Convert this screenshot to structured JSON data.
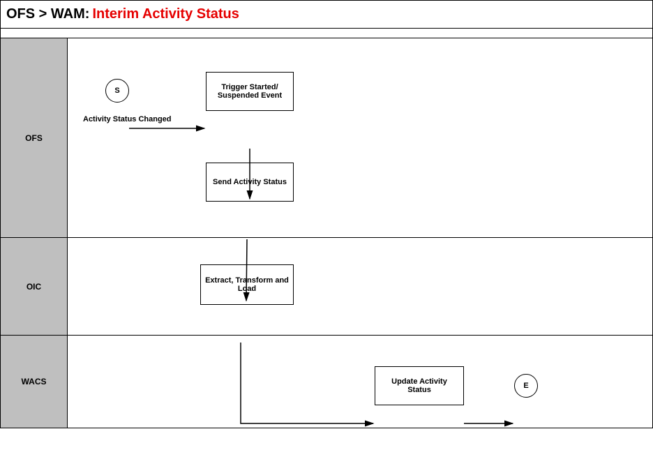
{
  "title": {
    "prefix": "OFS > WAM:",
    "main": "Interim Activity Status"
  },
  "lanes": {
    "ofs": "OFS",
    "oic": "OIC",
    "wacs": "WACS"
  },
  "nodes": {
    "start": "S",
    "end": "E",
    "trigger_box": "Trigger Started/ Suspended Event",
    "send_box": "Send Activity Status",
    "etl_box": "Extract, Transform and Load",
    "update_box": "Update Activity Status"
  },
  "captions": {
    "status_changed": "Activity Status Changed"
  },
  "chart_data": {
    "type": "swimlane-flow",
    "title": "OFS > WAM: Interim Activity Status",
    "lanes": [
      "OFS",
      "OIC",
      "WACS"
    ],
    "nodes": [
      {
        "id": "start",
        "lane": "OFS",
        "type": "start",
        "label": "S"
      },
      {
        "id": "trigger",
        "lane": "OFS",
        "type": "process",
        "label": "Trigger Started/ Suspended Event"
      },
      {
        "id": "send",
        "lane": "OFS",
        "type": "process",
        "label": "Send Activity Status"
      },
      {
        "id": "etl",
        "lane": "OIC",
        "type": "process",
        "label": "Extract, Transform and Load"
      },
      {
        "id": "update",
        "lane": "WACS",
        "type": "process",
        "label": "Update Activity Status"
      },
      {
        "id": "end",
        "lane": "WACS",
        "type": "end",
        "label": "E"
      }
    ],
    "edges": [
      {
        "from": "start",
        "to": "trigger",
        "label": "Activity Status Changed"
      },
      {
        "from": "trigger",
        "to": "send"
      },
      {
        "from": "send",
        "to": "etl"
      },
      {
        "from": "etl",
        "to": "update"
      },
      {
        "from": "update",
        "to": "end"
      }
    ]
  }
}
